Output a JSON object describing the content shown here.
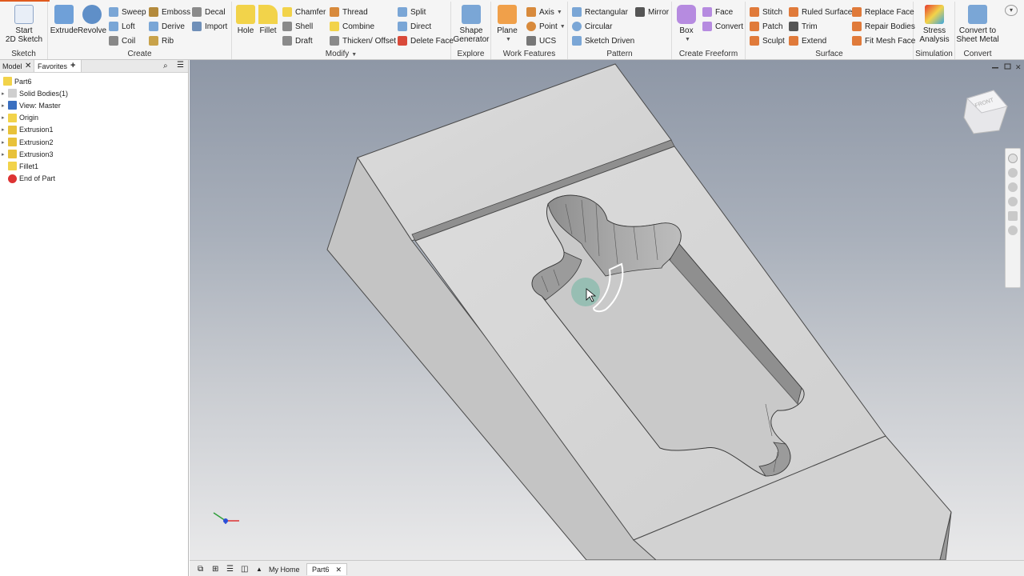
{
  "ribbon": {
    "sketch": {
      "start": "Start\n2D Sketch",
      "label": "Sketch"
    },
    "create": {
      "extrude": "Extrude",
      "revolve": "Revolve",
      "sweep": "Sweep",
      "loft": "Loft",
      "coil": "Coil",
      "emboss": "Emboss",
      "derive": "Derive",
      "rib": "Rib",
      "decal": "Decal",
      "import": "Import",
      "label": "Create"
    },
    "modify": {
      "hole": "Hole",
      "fillet": "Fillet",
      "chamfer": "Chamfer",
      "shell": "Shell",
      "draft": "Draft",
      "thread": "Thread",
      "combine": "Combine",
      "thicken": "Thicken/ Offset",
      "split": "Split",
      "direct": "Direct",
      "delete_face": "Delete Face",
      "label": "Modify"
    },
    "explore": {
      "shape_gen": "Shape\nGenerator",
      "label": "Explore"
    },
    "work": {
      "plane": "Plane",
      "axis": "Axis",
      "point": "Point",
      "ucs": "UCS",
      "label": "Work Features"
    },
    "pattern": {
      "rect": "Rectangular",
      "circ": "Circular",
      "sketch_driven": "Sketch Driven",
      "mirror": "Mirror",
      "label": "Pattern"
    },
    "freeform": {
      "box": "Box",
      "face": "Face",
      "convert": "Convert",
      "label": "Create Freeform"
    },
    "surface": {
      "stitch": "Stitch",
      "patch": "Patch",
      "sculpt": "Sculpt",
      "ruled": "Ruled Surface",
      "trim": "Trim",
      "extend": "Extend",
      "replace": "Replace Face",
      "repair": "Repair Bodies",
      "fitmesh": "Fit Mesh Face",
      "label": "Surface"
    },
    "simulation": {
      "stress": "Stress\nAnalysis",
      "label": "Simulation"
    },
    "convert": {
      "sheet": "Convert to\nSheet Metal",
      "label": "Convert"
    }
  },
  "panel": {
    "tab_model": "Model",
    "tab_favorites": "Favorites",
    "add": "+",
    "tree": [
      "Part6",
      "Solid Bodies(1)",
      "View: Master",
      "Origin",
      "Extrusion1",
      "Extrusion2",
      "Extrusion3",
      "Fillet1",
      "End of Part"
    ]
  },
  "viewcube": {
    "label": "FRONT"
  },
  "tabs": {
    "home": "My Home",
    "doc": "Part6"
  },
  "colors": {
    "accent": "#e05a1e",
    "selection": "#ffffff",
    "hover_dot": "#3aa88a"
  }
}
